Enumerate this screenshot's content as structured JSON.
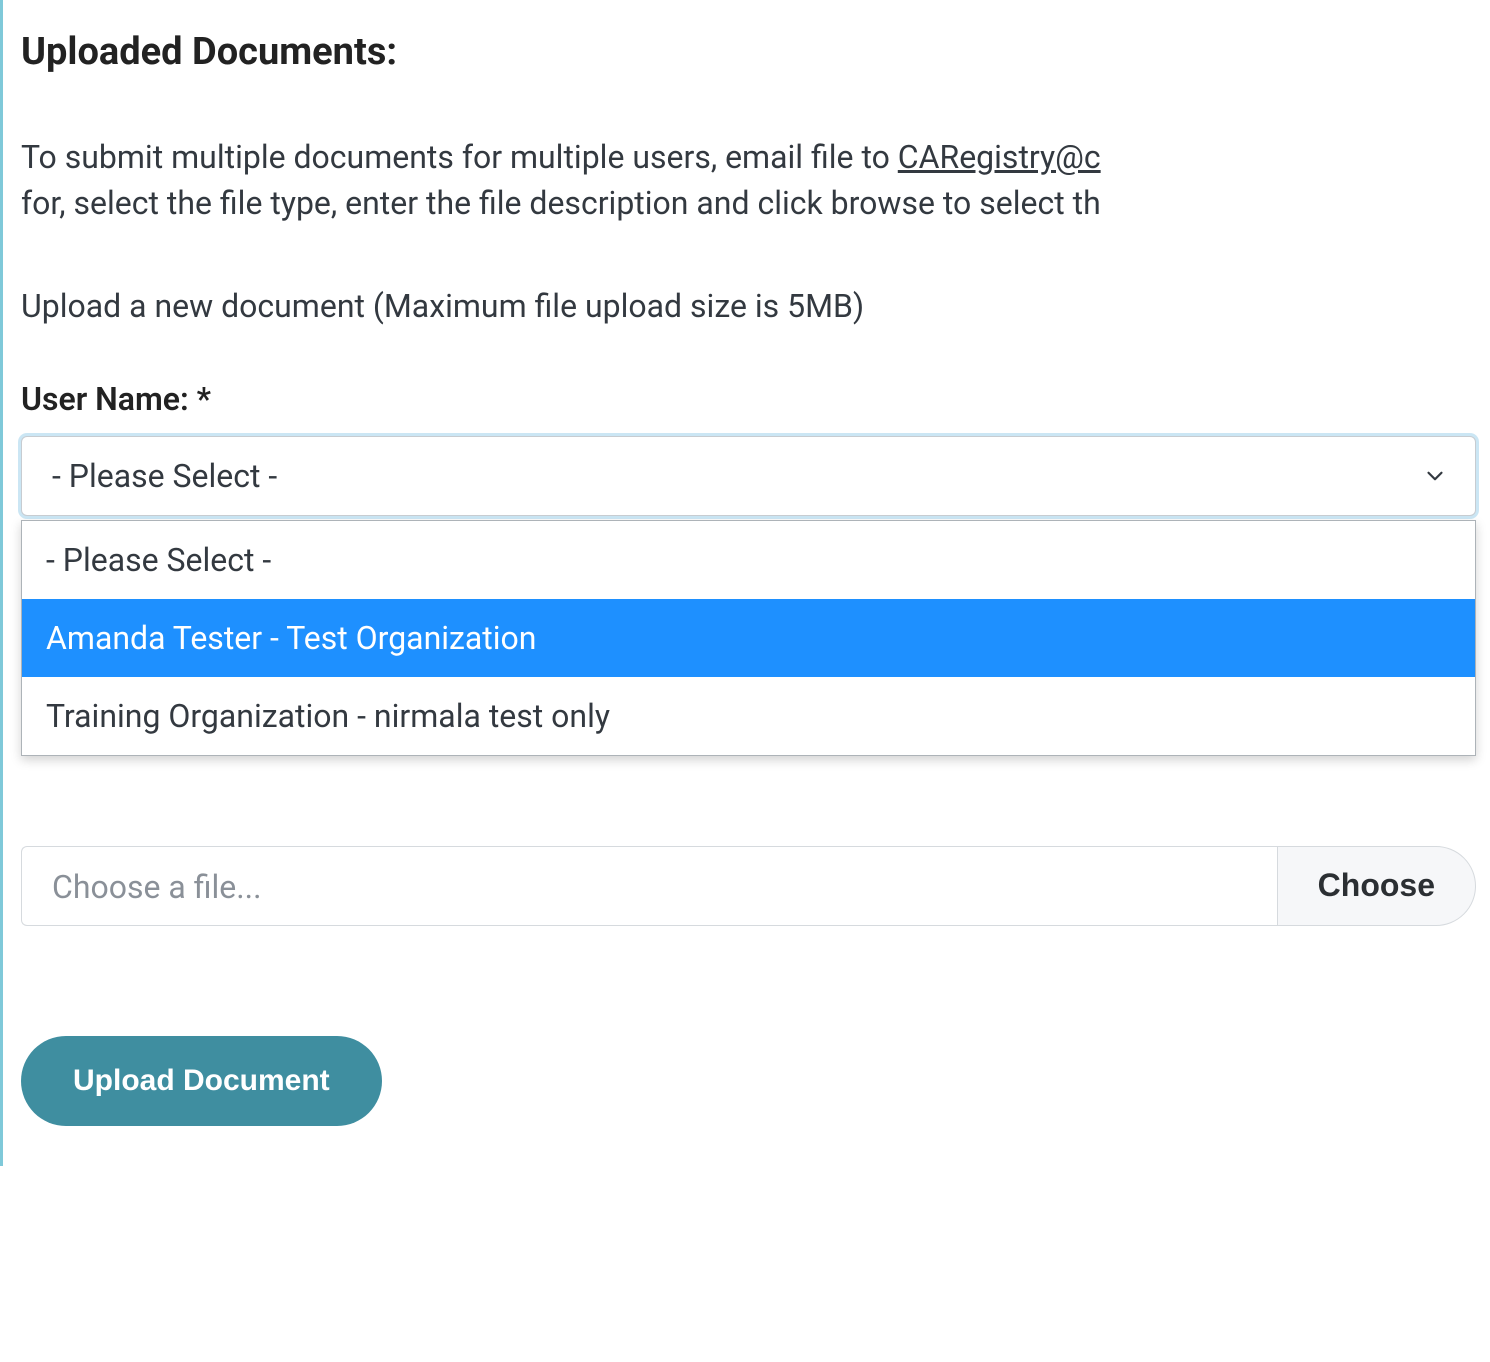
{
  "heading": "Uploaded Documents:",
  "instructions_line1_prefix": "To submit multiple documents for multiple users, email file to ",
  "instructions_line1_link": "CARegistry@c",
  "instructions_line2": "for, select the file type, enter the file description and click browse to select th",
  "upload_subheading": "Upload a new document (Maximum file upload size is 5MB)",
  "user_name_label": "User Name: *",
  "select": {
    "selected": "- Please Select -",
    "options": [
      {
        "label": "- Please Select -",
        "highlighted": false
      },
      {
        "label": "Amanda Tester - Test Organization",
        "highlighted": true
      },
      {
        "label": "Training Organization - nirmala test only",
        "highlighted": false
      }
    ]
  },
  "file": {
    "placeholder": "Choose a file...",
    "choose_label": "Choose"
  },
  "upload_button": "Upload Document"
}
